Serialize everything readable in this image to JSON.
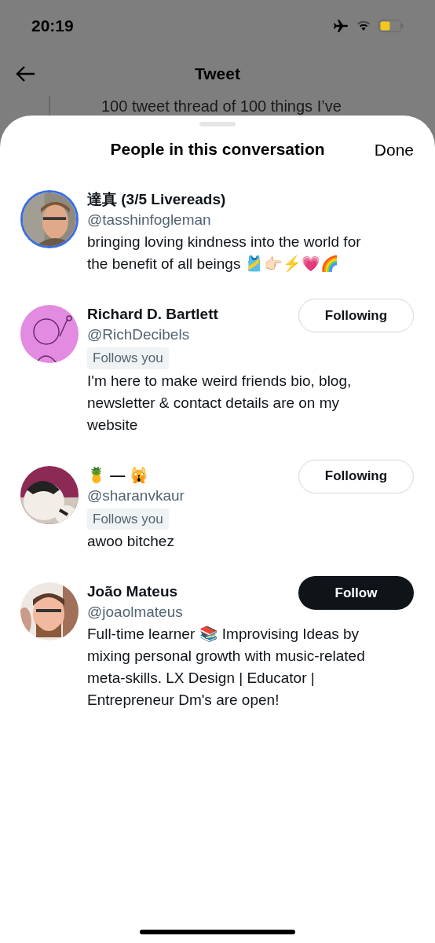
{
  "status_bar": {
    "time": "20:19"
  },
  "background": {
    "title": "Tweet",
    "tweet_text": "100 tweet thread of 100 things I’ve"
  },
  "sheet": {
    "title": "People in this conversation",
    "done": "Done"
  },
  "people": [
    {
      "name": "達真 (3/5 Livereads)",
      "handle": "@tasshinfogleman",
      "follows_you": false,
      "story_ring": true,
      "bio": "bringing loving kindness into the world for the benefit of all beings 🎽👉🏻⚡️💗🌈"
    },
    {
      "name": "Richard D. Bartlett",
      "handle": "@RichDecibels",
      "follows_you": true,
      "follows_you_label": "Follows you",
      "story_ring": false,
      "button": {
        "label": "Following",
        "kind": "following"
      },
      "bio": "I'm here to make weird friends bio, blog, newsletter & contact details are on my website"
    },
    {
      "name": "🍍 — 🙀",
      "handle": "@sharanvkaur",
      "follows_you": true,
      "follows_you_label": "Follows you",
      "story_ring": false,
      "button": {
        "label": "Following",
        "kind": "following"
      },
      "bio": "awoo bitchez"
    },
    {
      "name": "João Mateus",
      "handle": "@joaolmateus",
      "follows_you": false,
      "story_ring": false,
      "button": {
        "label": "Follow",
        "kind": "follow"
      },
      "bio": "Full-time learner 📚 Improvising Ideas by mixing personal growth with music-related meta-skills. LX Design | Educator | Entrepreneur Dm's are open!"
    }
  ]
}
